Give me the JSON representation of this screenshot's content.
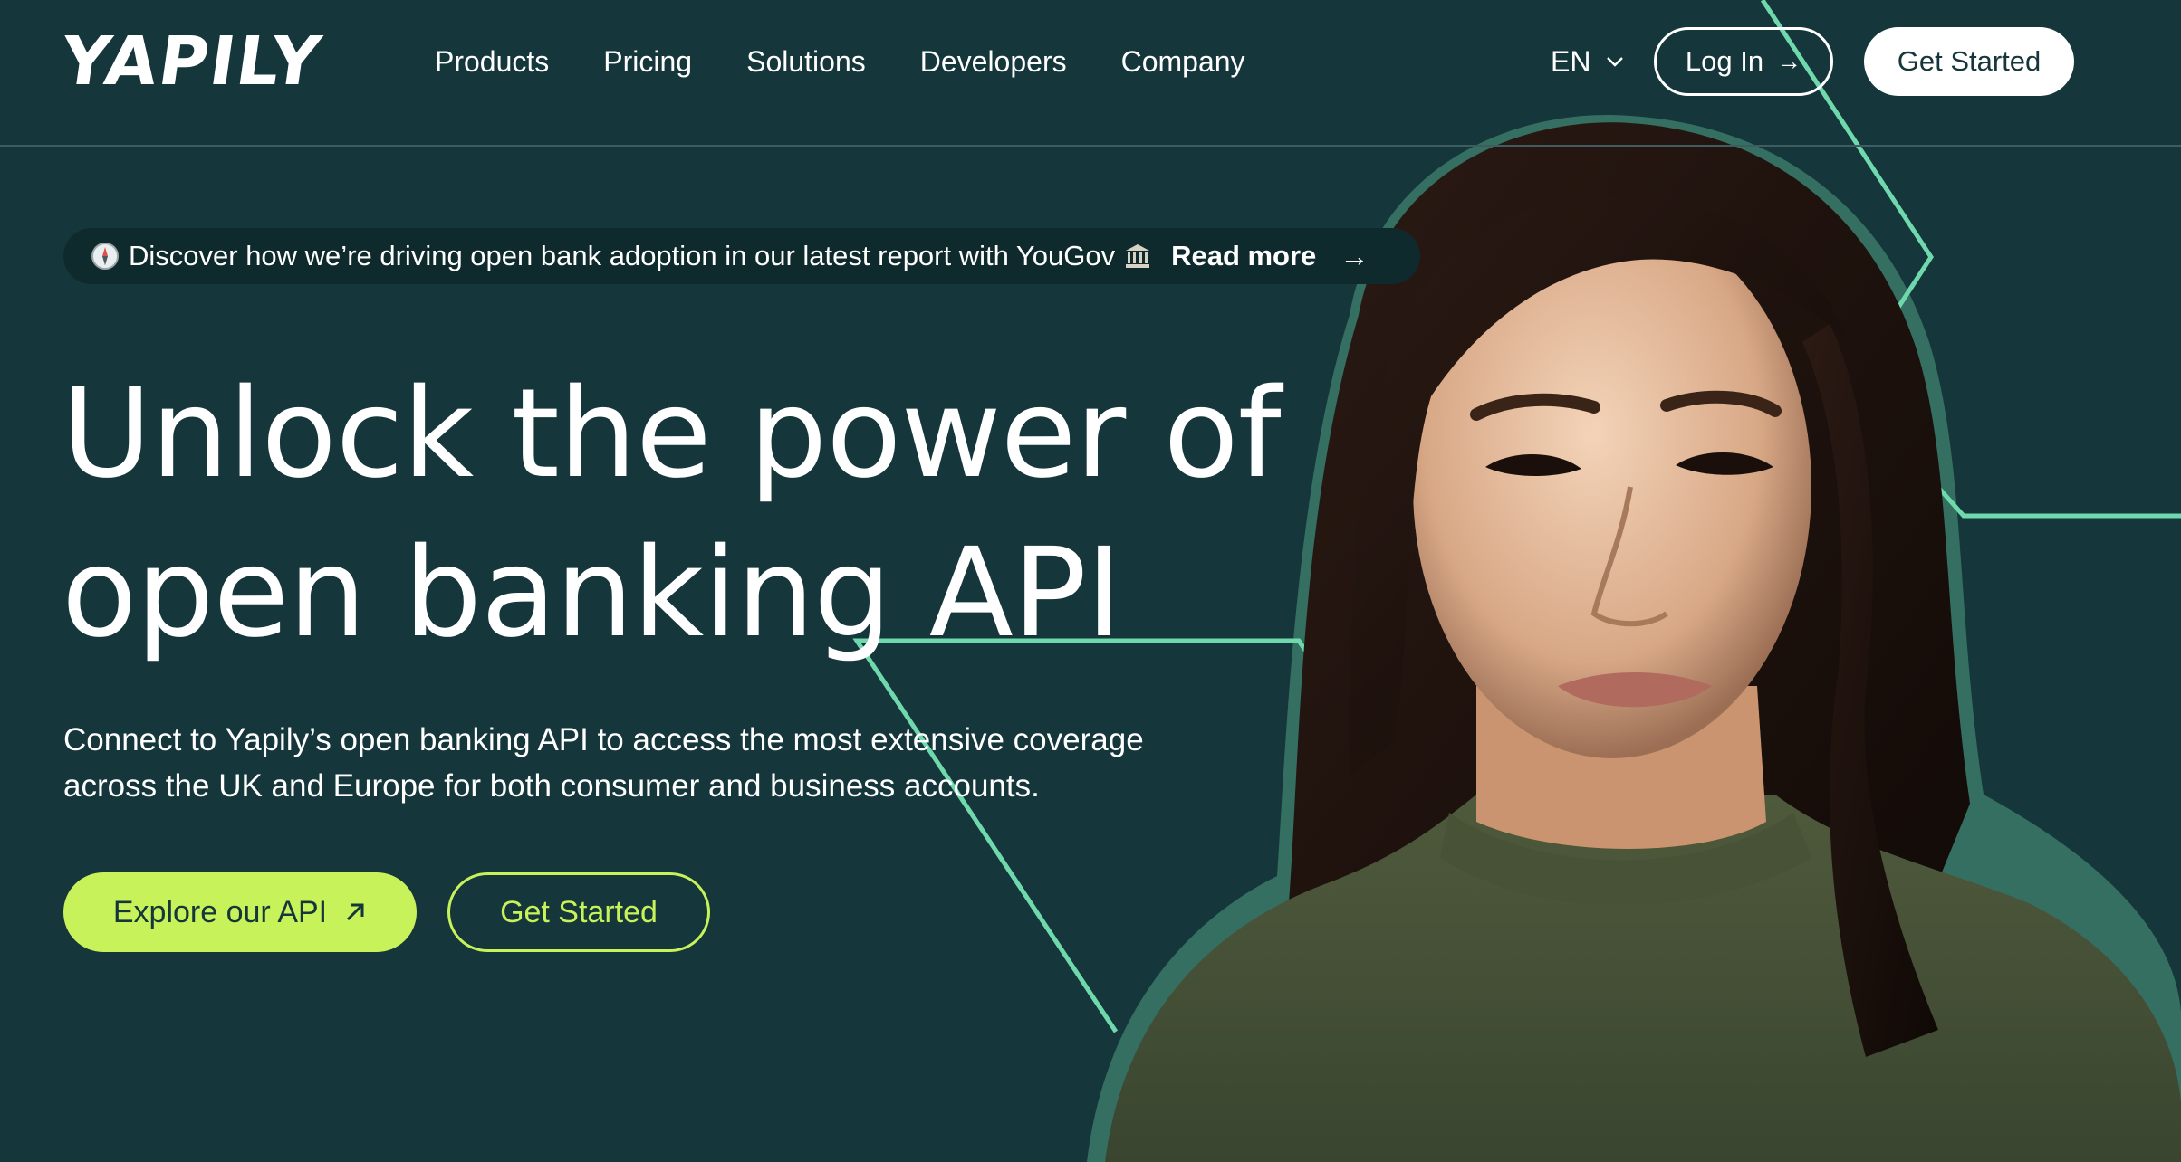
{
  "brand": {
    "logo_text": "YAPILY"
  },
  "nav": {
    "items": [
      {
        "label": "Products"
      },
      {
        "label": "Pricing"
      },
      {
        "label": "Solutions"
      },
      {
        "label": "Developers"
      },
      {
        "label": "Company"
      }
    ],
    "language": "EN",
    "login_label": "Log In",
    "get_started_label": "Get Started"
  },
  "banner": {
    "text": "Discover how we’re driving open bank adoption in our latest report with YouGov",
    "link_label": "Read more",
    "icons": [
      "compass-icon",
      "bank-icon",
      "arrow-right-icon"
    ]
  },
  "hero": {
    "title_line1": "Unlock the power of",
    "title_line2": "open banking API",
    "subtitle_line1": "Connect to Yapily’s open banking API to access the most extensive coverage",
    "subtitle_line2": "across the UK and Europe for both consumer and business accounts.",
    "primary_cta": "Explore our API",
    "secondary_cta": "Get Started"
  },
  "colors": {
    "background": "#15363a",
    "accent_lime": "#c8f25a",
    "line_mint": "#6fd9ad",
    "banner_bg": "#0f2a2d"
  }
}
